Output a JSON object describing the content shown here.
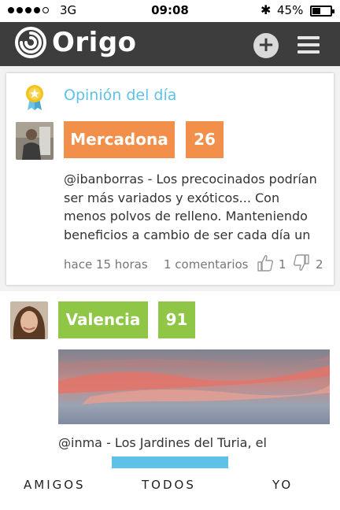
{
  "status": {
    "network": "3G",
    "time": "09:08",
    "battery": "45%",
    "battery_level": 0.45
  },
  "app": {
    "brand": "Origo"
  },
  "featured": {
    "title": "Opinión del día",
    "tag": "Mercadona",
    "score": "26",
    "handle": "@ibanborras",
    "text": " - Los precocinados podrían ser más variados y exóticos... Con menos polvos de relleno. Manteniendo beneficios a cambio de ser cada día un",
    "time": "hace 15 horas",
    "comments": "1 comentarios",
    "likes": "1",
    "dislikes": "2"
  },
  "post2": {
    "tag": "Valencia",
    "score": "91",
    "handle": "@inma",
    "text": " - Los Jardines del Turia, el"
  },
  "tabs": {
    "friends": "AMIGOS",
    "all": "TODOS",
    "me": "YO"
  },
  "colors": {
    "orange": "#f28f4b",
    "green": "#8fc646",
    "blue": "#5ec1e8",
    "header": "#3d3d3d"
  }
}
